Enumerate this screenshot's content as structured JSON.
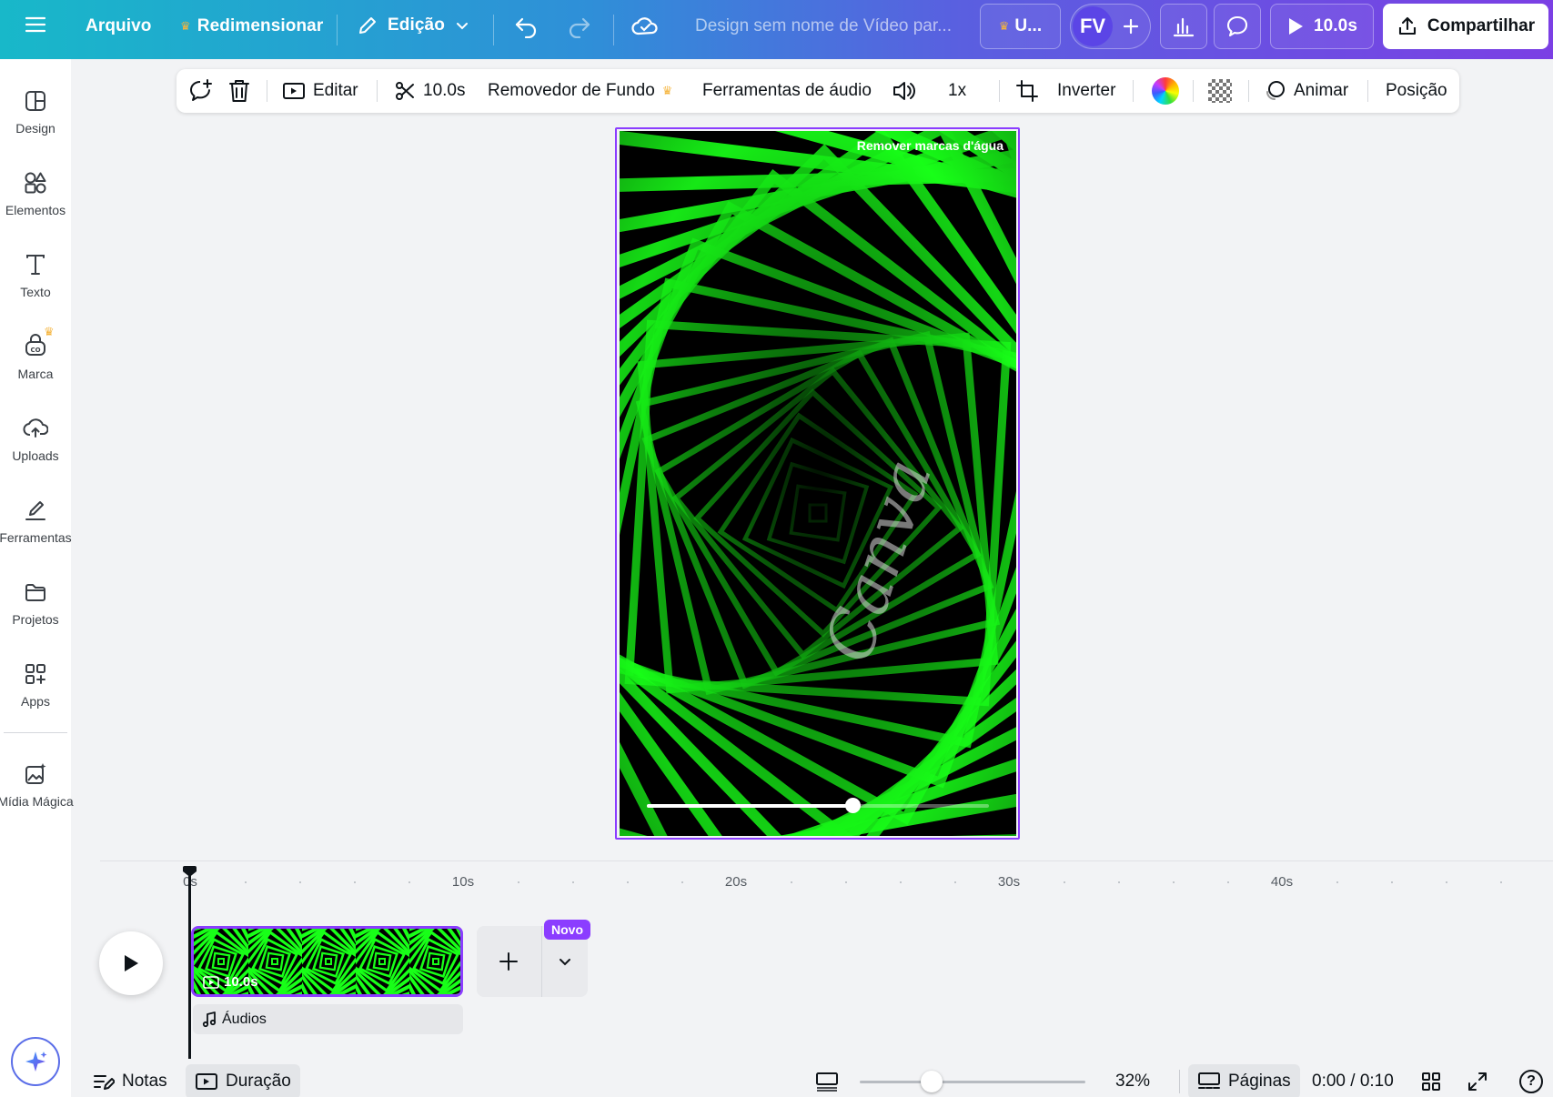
{
  "topbar": {
    "menu_icon": "hamburger-menu-icon",
    "file_label": "Arquivo",
    "resize_label": "Redimensionar",
    "edit_mode_label": "Edição",
    "design_title": "Design sem nome de Vídeo par...",
    "upgrade_label": "U...",
    "avatar_initials": "FV",
    "play_duration": "10.0s",
    "share_label": "Compartilhar"
  },
  "sidebar": {
    "items": [
      {
        "label": "Design",
        "icon": "design-layout-icon"
      },
      {
        "label": "Elementos",
        "icon": "elements-shapes-icon"
      },
      {
        "label": "Texto",
        "icon": "text-icon"
      },
      {
        "label": "Marca",
        "icon": "brand-icon"
      },
      {
        "label": "Uploads",
        "icon": "cloud-upload-icon"
      },
      {
        "label": "Ferramentas",
        "icon": "draw-tools-icon"
      },
      {
        "label": "Projetos",
        "icon": "folder-icon"
      },
      {
        "label": "Apps",
        "icon": "apps-grid-icon"
      },
      {
        "label": "Mídia Mágica",
        "icon": "magic-media-icon"
      }
    ]
  },
  "toolbar": {
    "edit_label": "Editar",
    "trim_duration": "10.0s",
    "bg_remover_label": "Removedor de Fundo",
    "audio_tools_label": "Ferramentas de áudio",
    "speed_label": "1x",
    "flip_label": "Inverter",
    "animate_label": "Animar",
    "position_label": "Posição"
  },
  "canvas": {
    "remove_watermark_label": "Remover marcas d'água",
    "watermark_text": "Canva",
    "seek_progress": 0.6
  },
  "timeline": {
    "ruler_labels": [
      "0s",
      "10s",
      "20s",
      "30s",
      "40s"
    ],
    "clip_duration": "10.0s",
    "new_badge": "Novo",
    "audio_label": "Áudios"
  },
  "bottombar": {
    "notes_label": "Notas",
    "duration_label": "Duração",
    "zoom_percent": "32%",
    "zoom_level": 0.32,
    "pages_label": "Páginas",
    "time_display": "0:00 / 0:10",
    "help_label": "?"
  },
  "colors": {
    "accent_purple": "#8b3dff",
    "crown_gold": "#f5b43c",
    "art_green": "#18ff18"
  }
}
